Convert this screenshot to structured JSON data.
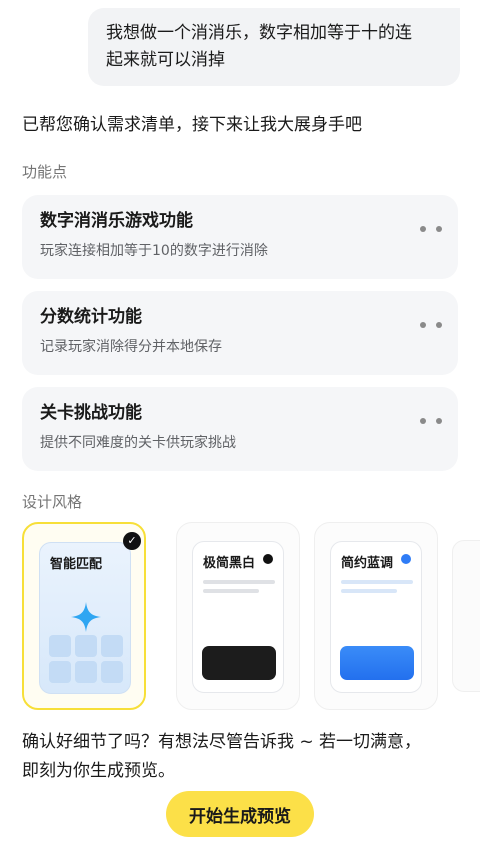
{
  "user_message": {
    "line1": "我想做一个消消乐，数字相加等于十的连",
    "line2": "起来就可以消掉"
  },
  "assistant_reply": "已帮您确认需求清单，接下来让我大展身手吧",
  "features": {
    "section_label": "功能点",
    "items": [
      {
        "title": "数字消消乐游戏功能",
        "desc": "玩家连接相加等于10的数字进行消除"
      },
      {
        "title": "分数统计功能",
        "desc": "记录玩家消除得分并本地保存"
      },
      {
        "title": "关卡挑战功能",
        "desc": "提供不同难度的关卡供玩家挑战"
      }
    ]
  },
  "design": {
    "section_label": "设计风格",
    "styles": [
      {
        "label": "智能匹配",
        "selected": true
      },
      {
        "label": "极简黑白",
        "selected": false,
        "dot_color": "#111111",
        "block_color": "#1c1c1c"
      },
      {
        "label": "简约蓝调",
        "selected": false,
        "dot_color": "#2f7cf6",
        "block_color": "#2f7cf6"
      }
    ]
  },
  "confirm": {
    "line1": "确认好细节了吗？有想法尽管告诉我 ~ 若一切满意，",
    "line2": "即刻为你生成预览。"
  },
  "primary_button": {
    "label": "开始生成预览"
  },
  "colors": {
    "accent_yellow": "#fce048",
    "selected_border": "#f7df38",
    "card_bg": "#f5f6f8"
  }
}
